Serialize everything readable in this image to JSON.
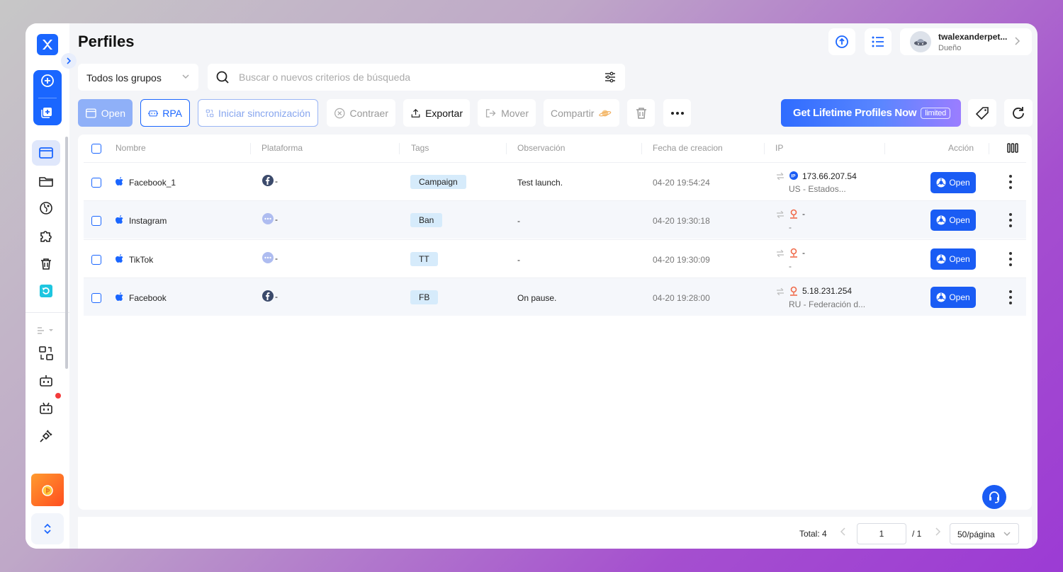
{
  "header": {
    "title": "Perfiles"
  },
  "user": {
    "name": "twalexanderpet...",
    "role": "Dueño"
  },
  "filters": {
    "group": "Todos los grupos",
    "search_placeholder": "Buscar o nuevos criterios de búsqueda"
  },
  "toolbar": {
    "open": "Open",
    "rpa": "RPA",
    "sync": "Iniciar sincronización",
    "collapse": "Contraer",
    "export": "Exportar",
    "move": "Mover",
    "share": "Compartir"
  },
  "banner": {
    "text": "Get Lifetime Profiles Now",
    "badge": "limited"
  },
  "table": {
    "columns": [
      "Nombre",
      "Plataforma",
      "Tags",
      "Observación",
      "Fecha de creacion",
      "IP",
      "Acción"
    ],
    "rows": [
      {
        "name": "Facebook_1",
        "platform": "-",
        "platform_icon": "facebook-icon",
        "tag": "Campaign",
        "note": "Test launch.",
        "created": "04-20 19:54:24",
        "ip": "173.66.207.54",
        "ip_location": "US - Estados...",
        "ip_icon": "ip-badge-icon",
        "action": "Open"
      },
      {
        "name": "Instagram",
        "platform": "-",
        "platform_icon": "more-platform-icon",
        "tag": "Ban",
        "note": "-",
        "created": "04-20 19:30:18",
        "ip": "-",
        "ip_location": "-",
        "ip_icon": "location-pin-icon",
        "action": "Open"
      },
      {
        "name": "TikTok",
        "platform": "-",
        "platform_icon": "more-platform-icon",
        "tag": "TT",
        "note": "-",
        "created": "04-20 19:30:09",
        "ip": "-",
        "ip_location": "-",
        "ip_icon": "location-pin-icon",
        "action": "Open"
      },
      {
        "name": "Facebook",
        "platform": "-",
        "platform_icon": "facebook-icon",
        "tag": "FB",
        "note": "On pause.",
        "created": "04-20 19:28:00",
        "ip": "5.18.231.254",
        "ip_location": "RU - Federación d...",
        "ip_icon": "location-pin-icon",
        "action": "Open"
      }
    ]
  },
  "pagination": {
    "total": "Total: 4",
    "page": "1",
    "of": "/ 1",
    "page_size": "50/página"
  },
  "colors": {
    "accent": "#1a66ff",
    "tag_bg": "#d6ebfb",
    "open_btn": "#1a5cf4"
  }
}
